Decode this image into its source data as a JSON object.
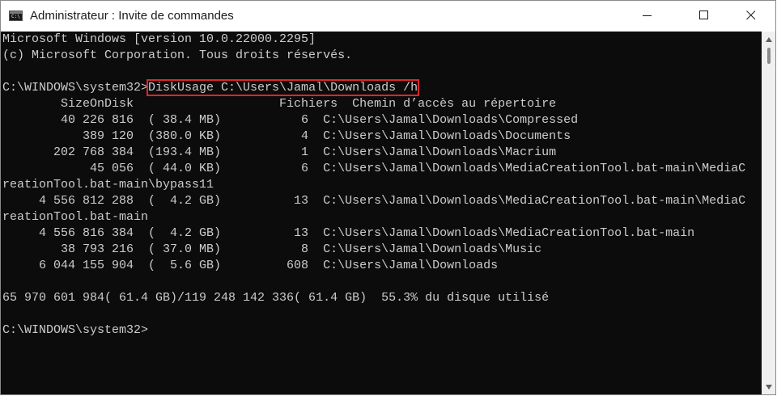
{
  "window": {
    "title": "Administrateur : Invite de commandes",
    "icon": "cmd-icon",
    "controls": [
      "minimize-icon",
      "maximize-icon",
      "close-icon"
    ]
  },
  "terminal": {
    "colors": {
      "background": "#0c0c0c",
      "text": "#cccccc",
      "highlight_border": "#e0242a"
    },
    "lines": [
      "Microsoft Windows [version 10.0.22000.2295]",
      "(c) Microsoft Corporation. Tous droits réservés.",
      "",
      "C:\\WINDOWS\\system32>",
      "        SizeOnDisk                    Fichiers  Chemin d’accès au répertoire",
      "        40 226 816  ( 38.4 MB)           6  C:\\Users\\Jamal\\Downloads\\Compressed",
      "           389 120  (380.0 KB)           4  C:\\Users\\Jamal\\Downloads\\Documents",
      "       202 768 384  (193.4 MB)           1  C:\\Users\\Jamal\\Downloads\\Macrium",
      "            45 056  ( 44.0 KB)           6  C:\\Users\\Jamal\\Downloads\\MediaCreationTool.bat-main\\MediaC",
      "reationTool.bat-main\\bypass11",
      "     4 556 812 288  (  4.2 GB)          13  C:\\Users\\Jamal\\Downloads\\MediaCreationTool.bat-main\\MediaC",
      "reationTool.bat-main",
      "     4 556 816 384  (  4.2 GB)          13  C:\\Users\\Jamal\\Downloads\\MediaCreationTool.bat-main",
      "        38 793 216  ( 37.0 MB)           8  C:\\Users\\Jamal\\Downloads\\Music",
      "     6 044 155 904  (  5.6 GB)         608  C:\\Users\\Jamal\\Downloads",
      "",
      "65 970 601 984( 61.4 GB)/119 248 142 336( 61.4 GB)  55.3% du disque utilisé",
      "",
      "C:\\WINDOWS\\system32>"
    ],
    "command": "DiskUsage C:\\Users\\Jamal\\Downloads /h"
  }
}
